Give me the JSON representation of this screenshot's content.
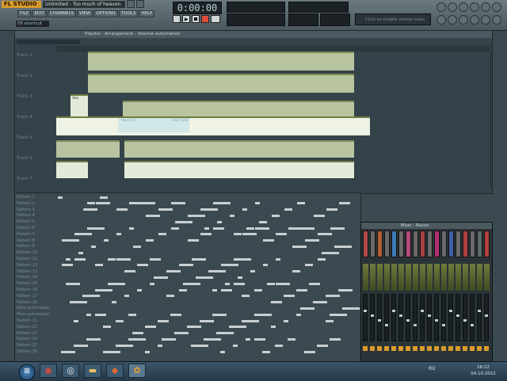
{
  "app": {
    "logo": "FL STUDIO",
    "song_title": "Unlimited - Too much of heaven",
    "hint_text": "F8 shortcut",
    "time_display": "0:00:00",
    "online_text": "Click to enable online news"
  },
  "menu": [
    "FILE",
    "EDIT",
    "CHANNELS",
    "VIEW",
    "OPTIONS",
    "TOOLS",
    "HELP"
  ],
  "playlist": {
    "title": "Playlist - Arrangement - Volume automation",
    "tracks": [
      "Track 1",
      "Track 2",
      "Track 3",
      "Track 4",
      "Track 5",
      "Track 6",
      "Track 7"
    ],
    "clip_labels": [
      "Vox",
      "Vox_Full",
      "Vox_Full2"
    ],
    "patterns": [
      "Pattern 1",
      "Pattern 2",
      "Pattern 3",
      "Pattern 4",
      "Pattern 5",
      "Pattern 6",
      "Pattern 7",
      "Pattern 8",
      "Pattern 9",
      "Pattern 10",
      "Pattern 11",
      "Pattern 12",
      "Pattern 13",
      "Pattern 14",
      "Pattern 15",
      "Pattern 16",
      "Pattern 17",
      "Pattern 18",
      "Main automation",
      "Main automation",
      "Pattern 21",
      "Pattern 22",
      "Pattern 23",
      "Pattern 24",
      "Pattern 25",
      "Pattern 26"
    ]
  },
  "mixer": {
    "title": "Mixer - Master"
  },
  "taskbar": {
    "language": "RU",
    "time": "16:22",
    "date": "04.10.2012",
    "apps": [
      "windows-explorer",
      "chrome",
      "media-player",
      "folder",
      "sound-editor",
      "fl-studio"
    ]
  },
  "colors": {
    "accent": "#d89a2c",
    "background": "#3a4a50",
    "clip": "#e3ead8"
  }
}
